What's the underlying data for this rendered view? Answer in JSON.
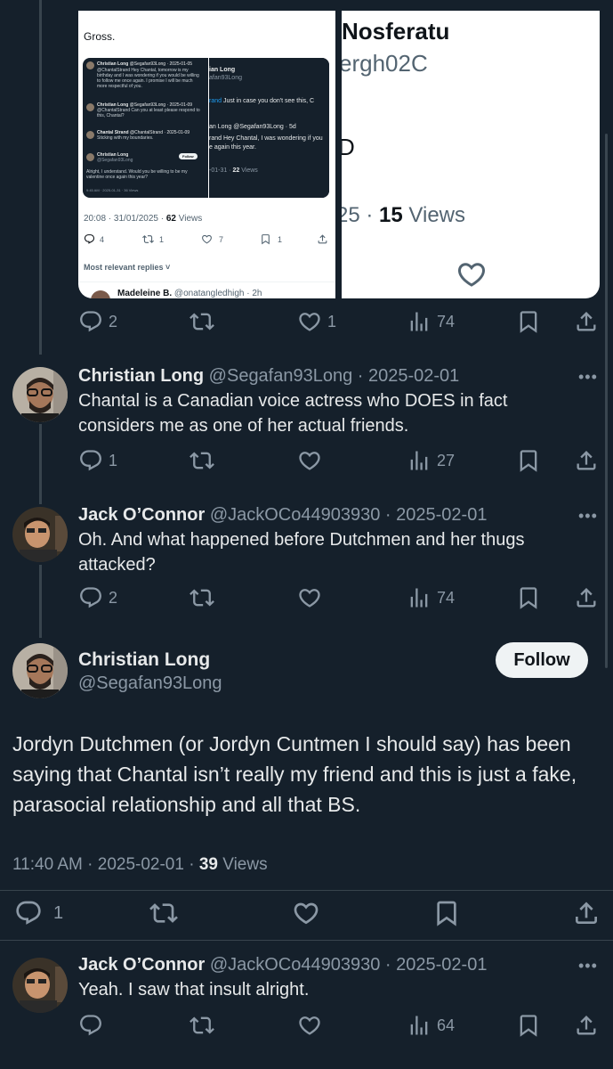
{
  "quoted_left": {
    "caption": "Gross.",
    "embed": {
      "author1": "Christian Long",
      "handle1": "@Segafan93Long · 2025-01-05",
      "text1": "@ChantalStrand Hey Chantal, tomorrow is my birthday and I was wondering if you would be willing to follow me once again. I promise I will be much more respectful of you.",
      "author2": "Christian Long",
      "handle2": "@Segafan93Long · 2025-01-09",
      "text2": "@ChantalStrand Can you at least please respond to this, Chantal?",
      "author3": "Chantal Strand",
      "handle3": "@ChantalStrand · 2025-01-09",
      "text3": "Sticking with my boundaries.",
      "author4": "Christian Long",
      "handle4": "@Segafan93Long",
      "follow": "Follow",
      "text4": "Alright, I understand. Would you be willing to be my valentine once again this year?",
      "time4": "9:45 AM · 2025-01-31 · 36 Views",
      "r_name": "ian Long",
      "r_handle": "afan93Long",
      "r_line1a": "rand",
      "r_line1b": "Just in case you don't see this, C",
      "r_line2": "an Long @Segafan93Long · 5d",
      "r_line3": "rand  Hey Chantal, I was wondering if you",
      "r_line4": "e again this year.",
      "r_line5a": "-01-31 ·",
      "r_line5b": "22",
      "r_line5c": "Views"
    },
    "meta_time": "20:08 · 31/01/2025 ·",
    "meta_views_count": "62",
    "meta_views_label": "Views",
    "counts": {
      "replies": "4",
      "retweets": "1",
      "likes": "7",
      "bookmarks": "1"
    },
    "replies_label": "Most relevant replies",
    "next_reply_name": "Madeleine B.",
    "next_reply_handle": "@onatangledhigh · 2h"
  },
  "quoted_right": {
    "name": "Nosferatu",
    "handle": "ergh02C",
    "d": "D",
    "views_prefix": "25 ·",
    "views_count": "15",
    "views_label": "Views"
  },
  "tweet0": {
    "replies": "2",
    "likes": "1",
    "views": "74"
  },
  "tweet1": {
    "name": "Christian Long",
    "handle": "@Segafan93Long · 2025-02-01",
    "text": "Chantal is a Canadian voice actress who DOES in fact considers me as one of her actual friends.",
    "replies": "1",
    "views": "27"
  },
  "tweet2": {
    "name": "Jack O’Connor",
    "handle": "@JackOCo44903930 · 2025-02-01",
    "text": "Oh. And what happened before Dutchmen and her thugs attacked?",
    "replies": "2",
    "views": "74"
  },
  "main": {
    "name": "Christian Long",
    "handle": "@Segafan93Long",
    "follow": "Follow",
    "text": "Jordyn Dutchmen (or Jordyn Cuntmen I should say) has been saying that Chantal isn’t really my friend and this is just a fake, parasocial relationship and all that BS.",
    "time": "11:40 AM · 2025-02-01 ·",
    "views_count": "39",
    "views_label": "Views",
    "replies": "1"
  },
  "tweet3": {
    "name": "Jack O’Connor",
    "handle": "@JackOCo44903930 · 2025-02-01",
    "text": "Yeah. I saw that insult alright.",
    "views": "64"
  },
  "more_glyph": "•••",
  "colors": {
    "background": "#15202b",
    "text": "#e7e9ea",
    "secondary": "#8b98a5",
    "divider": "#38444d",
    "link": "#1d9bf0"
  }
}
